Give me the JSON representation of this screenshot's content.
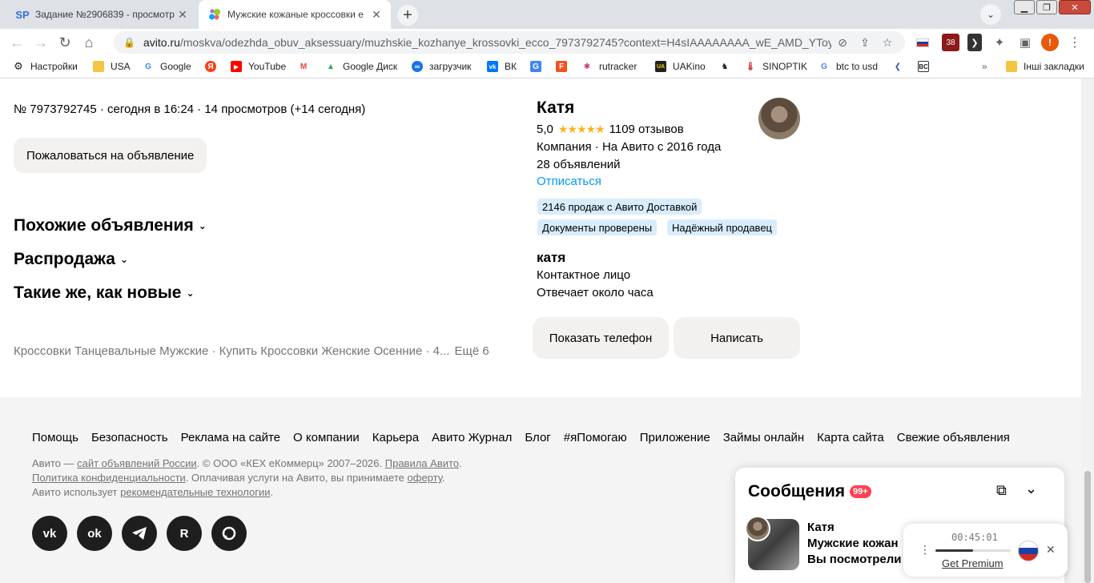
{
  "browser": {
    "tabs": [
      {
        "title": "Задание №2906839 - просмотр",
        "favicon": "SP",
        "active": false
      },
      {
        "title": "Мужские кожаные кроссовки e",
        "favicon": "avito-icon",
        "active": true
      }
    ],
    "url_host": "avito.ru",
    "url_path": "/moskva/odezhda_obuv_aksessuary/muzhskie_kozhanye_krossovki_ecco_7973792745?context=H4sIAAAAAAAA_wE_AMD_YToyO...",
    "profile_initial": "!",
    "ext_badge": "38"
  },
  "bookmarks": [
    {
      "label": "Настройки",
      "icon": "gear-icon"
    },
    {
      "label": "USA",
      "icon": "folder-icon"
    },
    {
      "label": "Google",
      "icon": "google-icon"
    },
    {
      "label": "",
      "icon": "yandex-icon"
    },
    {
      "label": "YouTube",
      "icon": "youtube-icon"
    },
    {
      "label": "",
      "icon": "gmail-icon"
    },
    {
      "label": "Google Диск",
      "icon": "drive-icon"
    },
    {
      "label": "загрузчик",
      "icon": "infinity-icon"
    },
    {
      "label": "ВК",
      "icon": "vk-icon"
    },
    {
      "label": "",
      "icon": "translate-icon"
    },
    {
      "label": "",
      "icon": "f-icon"
    },
    {
      "label": "rutracker",
      "icon": "rutracker-icon"
    },
    {
      "label": "UAKino",
      "icon": "uakino-icon"
    },
    {
      "label": "",
      "icon": "chess-icon"
    },
    {
      "label": "SINOPTIK",
      "icon": "thermometer-icon"
    },
    {
      "label": "btc to usd",
      "icon": "google-icon"
    },
    {
      "label": "",
      "icon": "arrow-icon"
    },
    {
      "label": "",
      "icon": "bc-icon"
    },
    {
      "label": "Інші закладки",
      "icon": "folder-icon"
    }
  ],
  "listing": {
    "ad_info": "№ 7973792745 · сегодня в 16:24 · 14 просмотров (+14 сегодня)",
    "report_button": "Пожаловаться на объявление",
    "sections": [
      "Похожие объявления",
      "Распродажа",
      "Такие же, как новые"
    ],
    "tags_line": "Кроссовки Танцевальные Мужские · Купить Кроссовки Женские Осенние · 4...",
    "tags_more": "Ещё 6"
  },
  "seller": {
    "name": "Катя",
    "rating": "5,0",
    "reviews": "1109 отзывов",
    "company_line": "Компания · На Авито с 2016 года",
    "ads_count": "28 объявлений",
    "unsubscribe": "Отписаться",
    "badges": [
      "2146 продаж с Авито Доставкой",
      "Документы проверены",
      "Надёжный продавец"
    ],
    "contact_name": "катя",
    "contact_role": "Контактное лицо",
    "response_time": "Отвечает около часа",
    "show_phone_button": "Показать телефон",
    "write_button": "Написать"
  },
  "footer": {
    "links": [
      "Помощь",
      "Безопасность",
      "Реклама на сайте",
      "О компании",
      "Карьера",
      "Авито Журнал",
      "Блог",
      "#яПомогаю",
      "Приложение",
      "Займы онлайн",
      "Карта сайта",
      "Свежие объявления"
    ],
    "legal_1a": "Авито — ",
    "legal_1b": "сайт объявлений России",
    "legal_1c": ". © ООО «КЕХ еКоммерц» 2007–2026. ",
    "legal_1d": "Правила Авито",
    "legal_1e": ".",
    "legal_2a": "Политика конфиденциальности",
    "legal_2b": ". Оплачивая услуги на Авито, вы принимаете ",
    "legal_2c": "оферту",
    "legal_2d": ".",
    "legal_3a": "Авито использует ",
    "legal_3b": "рекомендательные технологии",
    "legal_3c": ".",
    "social": [
      "vk-icon",
      "odnoklassniki-icon",
      "telegram-icon",
      "rutube-icon",
      "dzen-icon"
    ]
  },
  "messenger": {
    "title": "Сообщения",
    "count": "99+",
    "chat_name": "Катя",
    "chat_title": "Мужские кожан",
    "chat_text": "Вы посмотрели"
  },
  "vpn": {
    "time": "00:45:01",
    "link": "Get Premium",
    "progress": 0.5
  }
}
